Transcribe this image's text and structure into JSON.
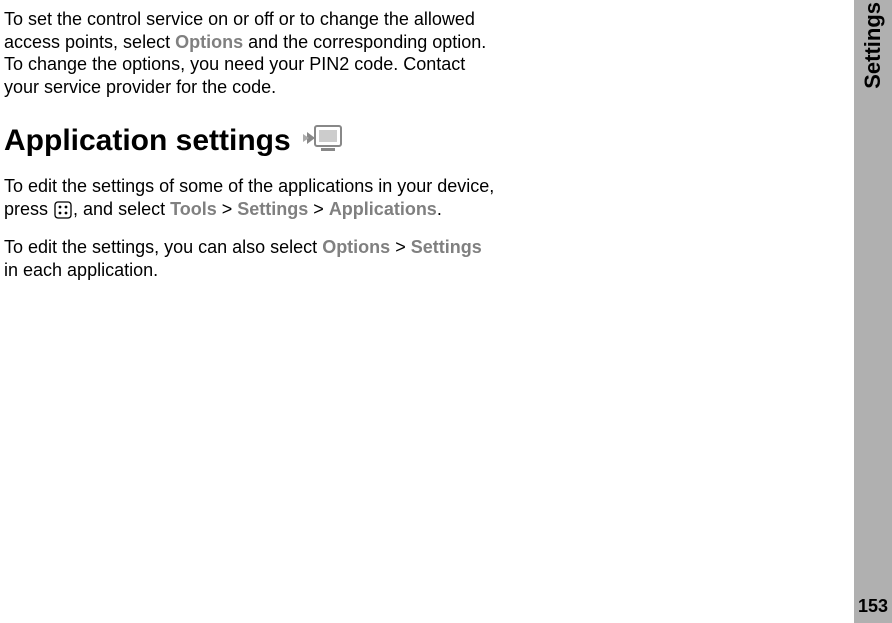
{
  "intro_paragraph": {
    "part1": "To set the control service on or off or to change the allowed access points, select ",
    "options": "Options",
    "part2": " and the corresponding option. To change the options, you need your PIN2 code. Contact your service provider for the code."
  },
  "heading": "Application settings",
  "para2": {
    "part1": "To edit the settings of some of the applications in your device, press ",
    "part2": ", and select ",
    "tools": "Tools",
    "gt1": " > ",
    "settings": "Settings",
    "gt2": " > ",
    "applications": "Applications",
    "part3": "."
  },
  "para3": {
    "part1": "To edit the settings, you can also select ",
    "options": "Options",
    "gt": " > ",
    "settings": "Settings",
    "part2": " in each application."
  },
  "sidebar_label": "Settings",
  "page_number": "153"
}
